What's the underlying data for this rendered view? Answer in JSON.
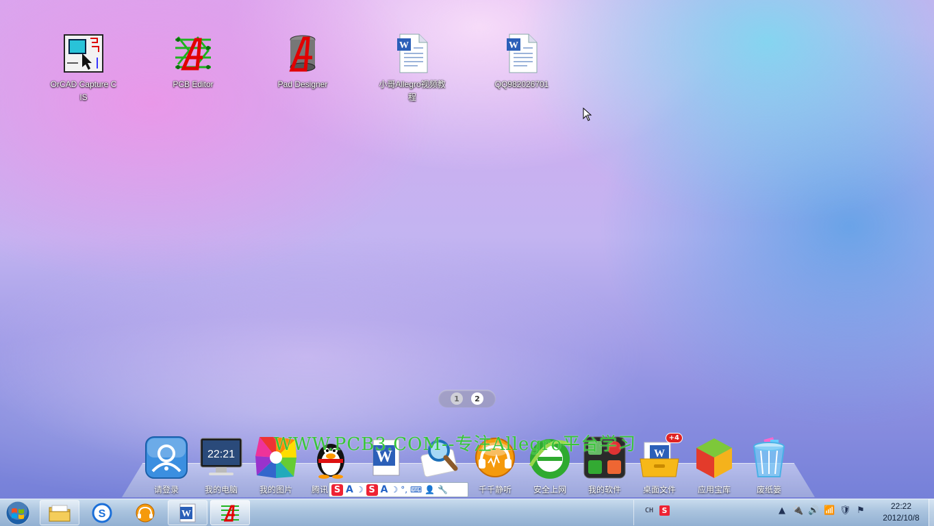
{
  "desktop": {
    "icons": [
      {
        "label": "OrCAD Capture CIS",
        "icon": "orcad-capture-icon"
      },
      {
        "label": "PCB Editor",
        "icon": "pcb-editor-icon"
      },
      {
        "label": "Pad Designer",
        "icon": "pad-designer-icon"
      },
      {
        "label": "小哥Allegro视频教程",
        "icon": "word-document-icon"
      },
      {
        "label": "QQ982026701",
        "icon": "word-document-icon"
      }
    ]
  },
  "pager": {
    "pages": [
      "1",
      "2"
    ],
    "active": "2"
  },
  "dock": {
    "items": [
      {
        "label": "请登录",
        "icon": "user-login-icon"
      },
      {
        "label": "我的电脑",
        "icon": "monitor-icon",
        "screen_time": "22:21"
      },
      {
        "label": "我的图片",
        "icon": "pictures-icon"
      },
      {
        "label": "腾讯",
        "icon": "qq-penguin-icon"
      },
      {
        "label": "",
        "icon": "word-icon"
      },
      {
        "label": "",
        "icon": "search-icon"
      },
      {
        "label": "千千静听",
        "icon": "ttplayer-icon"
      },
      {
        "label": "安全上网",
        "icon": "ie-browser-icon"
      },
      {
        "label": "我的软件",
        "icon": "software-grid-icon"
      },
      {
        "label": "桌面文件",
        "icon": "desktop-files-icon",
        "badge": "+4"
      },
      {
        "label": "应用宝库",
        "icon": "app-cube-icon"
      },
      {
        "label": "废纸篓",
        "icon": "recycle-bin-icon"
      }
    ],
    "watermark": "WWW.PCB3.COM--专注Allegro平台学习"
  },
  "ime": {
    "logo": "S",
    "letter": "A"
  },
  "taskbar": {
    "buttons": [
      "file-explorer-icon",
      "sogou-icon",
      "ttplayer-icon",
      "word-icon",
      "pcb-editor-icon"
    ],
    "lang": "CH",
    "ime_logo": "S",
    "time": "22:22",
    "date": "2012/10/8"
  }
}
